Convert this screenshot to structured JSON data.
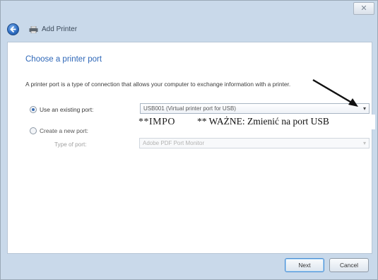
{
  "window": {
    "title": "Add Printer",
    "close_label": "✕"
  },
  "page": {
    "heading": "Choose a printer port",
    "description": "A printer port is a type of connection that allows your computer to exchange information with a printer."
  },
  "options": {
    "existing": {
      "label": "Use an existing port:",
      "selected": true,
      "value": "USB001 (Virtual printer port for USB)"
    },
    "new": {
      "label": "Create a new port:",
      "selected": false,
      "type_label": "Type of port:",
      "value": "Adobe PDF Port Monitor"
    }
  },
  "annotation": {
    "impo": "**IMPO",
    "note": "** WAŻNE: Zmienić na port USB"
  },
  "buttons": {
    "next": "Next",
    "cancel": "Cancel"
  },
  "colors": {
    "heading": "#2e67b8",
    "chrome": "#c9d9ea"
  }
}
